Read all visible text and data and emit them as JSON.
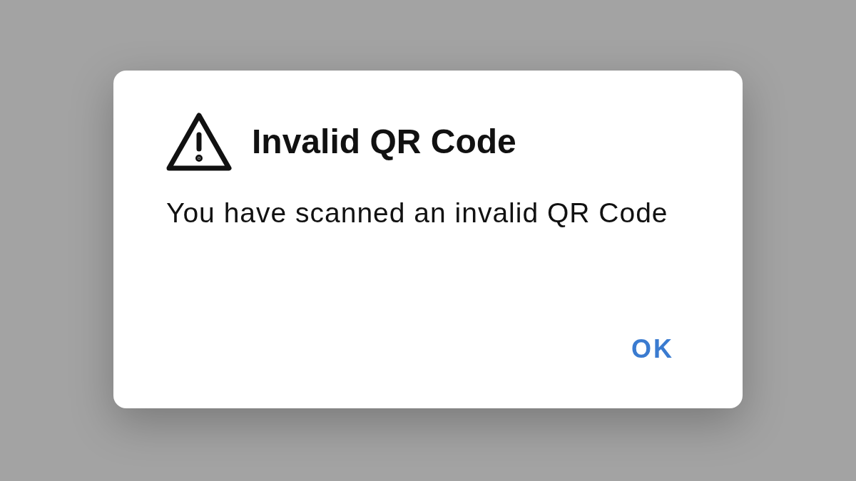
{
  "dialog": {
    "title": "Invalid QR Code",
    "message": "You have scanned an invalid QR Code",
    "buttons": [
      "OK"
    ]
  }
}
